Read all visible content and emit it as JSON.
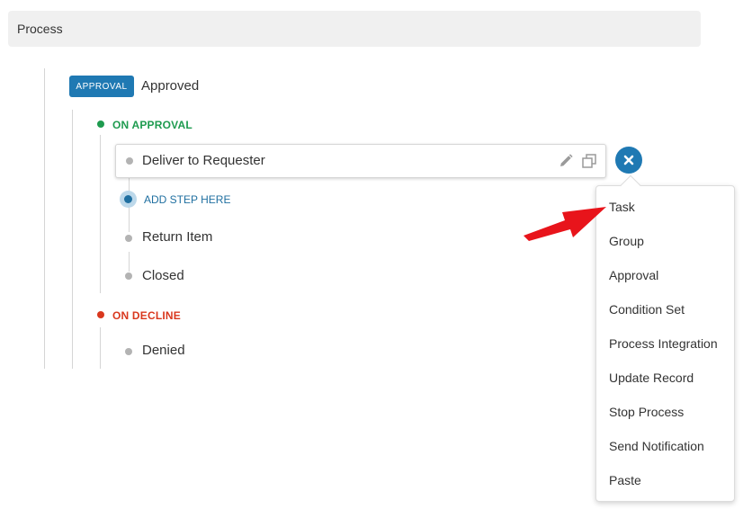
{
  "header": {
    "title": "Process"
  },
  "approval": {
    "badge": "APPROVAL",
    "status": "Approved"
  },
  "on_approval": {
    "label": "ON APPROVAL",
    "color": "#1e9b4f",
    "steps": [
      {
        "label": "Deliver to Requester"
      },
      {
        "label": "Return Item"
      },
      {
        "label": "Closed"
      }
    ],
    "add_step_label": "ADD STEP HERE"
  },
  "on_decline": {
    "label": "ON DECLINE",
    "color": "#d9381e",
    "steps": [
      {
        "label": "Denied"
      }
    ]
  },
  "menu": {
    "items": [
      {
        "label": "Task"
      },
      {
        "label": "Group"
      },
      {
        "label": "Approval"
      },
      {
        "label": "Condition Set"
      },
      {
        "label": "Process Integration"
      },
      {
        "label": "Update Record"
      },
      {
        "label": "Stop Process"
      },
      {
        "label": "Send Notification"
      },
      {
        "label": "Paste"
      }
    ]
  },
  "colors": {
    "accent": "#1f79b3",
    "arrow": "#e8141b"
  },
  "icons": {
    "edit": "pencil-icon",
    "copy": "copy-icon",
    "close": "close-icon",
    "pointer": "red-arrow-icon"
  }
}
